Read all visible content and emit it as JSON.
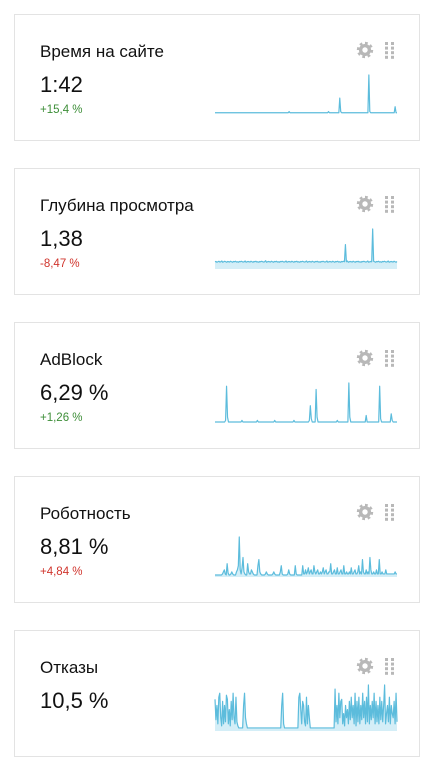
{
  "theme": {
    "spark_color": "#5cbcdc",
    "spark_fill": "#d4eef7",
    "icon_color": "#b8b8b8",
    "delta_up_color": "#3d8e38",
    "delta_down_color": "#d0342c"
  },
  "widgets": [
    {
      "title": "Время на сайте",
      "value": "1:42",
      "delta": "+15,4 %",
      "delta_direction": "up",
      "icons": [
        "gear-icon",
        "drag-handle-icon"
      ],
      "sparkline": {
        "fill": false,
        "values": [
          1,
          1,
          1,
          1,
          1,
          1,
          1,
          1,
          1,
          1,
          1,
          1,
          1,
          1,
          1,
          1,
          1,
          1,
          1,
          1,
          1,
          1,
          1,
          1,
          1,
          1,
          1,
          1,
          1,
          1,
          1,
          1,
          1,
          1,
          1,
          1,
          1,
          1,
          1,
          1,
          1,
          1,
          1,
          1,
          1,
          1,
          1,
          1,
          1,
          1,
          1,
          1,
          1,
          1,
          1,
          1,
          1,
          1,
          1,
          1,
          1,
          1,
          1,
          1,
          1,
          1,
          1,
          1,
          1,
          1,
          1,
          1,
          1,
          1,
          1,
          1,
          1,
          1,
          1,
          2,
          1,
          1,
          1,
          1,
          1,
          1,
          1,
          1,
          1,
          1,
          1,
          1,
          1,
          1,
          1,
          1,
          1,
          1,
          1,
          1,
          1,
          1,
          1,
          1,
          1,
          1,
          1,
          1,
          1,
          1,
          1,
          1,
          1,
          1,
          1,
          1,
          1,
          1,
          1,
          1,
          1,
          2,
          1,
          1,
          1,
          1,
          1,
          1,
          1,
          1,
          1,
          1,
          1,
          13,
          2,
          1,
          1,
          1,
          1,
          1,
          1,
          1,
          1,
          1,
          1,
          1,
          1,
          1,
          1,
          1,
          1,
          1,
          1,
          1,
          1,
          1,
          1,
          1,
          1,
          1,
          1,
          1,
          1,
          1,
          32,
          2,
          1,
          1,
          1,
          1,
          1,
          1,
          1,
          1,
          1,
          1,
          1,
          1,
          1,
          1,
          1,
          1,
          1,
          1,
          1,
          1,
          1,
          1,
          1,
          1,
          1,
          1,
          6,
          1,
          1
        ]
      }
    },
    {
      "title": "Глубина просмотра",
      "value": "1,38",
      "delta": "-8,47 %",
      "delta_direction": "down",
      "icons": [
        "gear-icon",
        "drag-handle-icon"
      ],
      "sparkline": {
        "fill": true,
        "values": [
          1.2,
          1.25,
          1.1,
          1.2,
          1.3,
          1.15,
          1.2,
          1.35,
          1.1,
          1.2,
          1.3,
          1.2,
          1.1,
          1.25,
          1.2,
          1.15,
          1.3,
          1.2,
          1.1,
          1.25,
          1.2,
          1.3,
          1.15,
          1.2,
          1.1,
          1.25,
          1.2,
          1.3,
          1.2,
          1.15,
          1.2,
          1.35,
          1.1,
          1.2,
          1.25,
          1.2,
          1.15,
          1.3,
          1.2,
          1.1,
          1.25,
          1.2,
          1.3,
          1.15,
          1.2,
          1.1,
          1.25,
          1.2,
          1.3,
          1.2,
          1.15,
          1.2,
          1.4,
          1.1,
          1.2,
          1.25,
          1.2,
          1.15,
          1.3,
          1.2,
          1.1,
          1.25,
          1.2,
          1.3,
          1.15,
          1.2,
          1.1,
          1.25,
          1.2,
          1.3,
          1.2,
          1.15,
          1.2,
          1.35,
          1.1,
          1.2,
          1.25,
          1.2,
          1.15,
          1.3,
          1.2,
          1.1,
          1.25,
          1.2,
          1.3,
          1.15,
          1.2,
          1.1,
          1.25,
          1.2,
          1.3,
          1.2,
          1.15,
          1.2,
          1.35,
          1.1,
          1.2,
          1.25,
          1.2,
          1.15,
          1.3,
          1.2,
          1.1,
          1.25,
          1.2,
          1.3,
          1.15,
          1.2,
          1.1,
          1.25,
          1.2,
          1.3,
          1.2,
          1.15,
          1.2,
          1.35,
          1.1,
          1.2,
          1.25,
          1.2,
          1.15,
          1.3,
          1.2,
          1.1,
          1.25,
          1.2,
          1.3,
          1.15,
          1.2,
          1.1,
          1.25,
          1.2,
          1.3,
          1.2,
          4.5,
          1.2,
          1.35,
          1.1,
          1.2,
          1.25,
          1.2,
          1.15,
          1.3,
          1.2,
          1.1,
          1.25,
          1.2,
          1.3,
          1.15,
          1.2,
          1.1,
          1.25,
          1.2,
          1.3,
          1.2,
          1.15,
          1.2,
          1.35,
          1.1,
          1.2,
          1.25,
          1.2,
          7.5,
          1.3,
          1.2,
          1.1,
          1.25,
          1.2,
          1.3,
          1.15,
          1.2,
          1.1,
          1.25,
          1.2,
          1.3,
          1.2,
          1.15,
          1.2,
          1.35,
          1.1,
          1.2,
          1.25,
          1.2,
          1.15,
          1.3,
          1.2,
          1.1,
          1.25
        ]
      }
    },
    {
      "title": "AdBlock",
      "value": "6,29 %",
      "delta": "+1,26 %",
      "delta_direction": "up",
      "icons": [
        "gear-icon",
        "drag-handle-icon"
      ],
      "sparkline": {
        "fill": false,
        "values": [
          0,
          0,
          0,
          0,
          0,
          0,
          0,
          0,
          0,
          0,
          0,
          1,
          22,
          3,
          0,
          0,
          0,
          0,
          0,
          0,
          0,
          0,
          0,
          0,
          0,
          0,
          0,
          0,
          1,
          0,
          0,
          0,
          0,
          0,
          0,
          0,
          0,
          0,
          0,
          0,
          0,
          0,
          0,
          0,
          1,
          0,
          0,
          0,
          0,
          0,
          0,
          0,
          0,
          0,
          0,
          0,
          0,
          0,
          0,
          0,
          0,
          0,
          1,
          0,
          0,
          0,
          0,
          0,
          0,
          0,
          0,
          0,
          0,
          0,
          0,
          0,
          0,
          0,
          0,
          0,
          0,
          0,
          1,
          0,
          0,
          0,
          0,
          0,
          0,
          0,
          0,
          0,
          0,
          0,
          0,
          0,
          0,
          0,
          1,
          10,
          2,
          0,
          0,
          0,
          0,
          20,
          3,
          0,
          0,
          0,
          0,
          0,
          0,
          0,
          0,
          0,
          0,
          0,
          0,
          0,
          0,
          0,
          0,
          0,
          0,
          0,
          0,
          1,
          0,
          0,
          0,
          0,
          0,
          0,
          0,
          0,
          0,
          0,
          0,
          24,
          3,
          0,
          0,
          0,
          0,
          0,
          0,
          0,
          0,
          0,
          0,
          0,
          0,
          0,
          0,
          0,
          0,
          4,
          0,
          0,
          0,
          0,
          0,
          0,
          0,
          0,
          0,
          0,
          0,
          0,
          0,
          22,
          2,
          0,
          0,
          0,
          0,
          0,
          0,
          0,
          0,
          0,
          0,
          5,
          1,
          0,
          0,
          0,
          0,
          0
        ]
      }
    },
    {
      "title": "Роботность",
      "value": "8,81 %",
      "delta": "+4,84 %",
      "delta_direction": "down",
      "icons": [
        "gear-icon",
        "drag-handle-icon"
      ],
      "sparkline": {
        "fill": true,
        "values": [
          0.5,
          0.5,
          0.5,
          0.5,
          0.5,
          0.5,
          0.5,
          0.5,
          1,
          2,
          3,
          1,
          0.5,
          6,
          1.5,
          0.5,
          0.5,
          1,
          2,
          1,
          0.5,
          0.5,
          0.5,
          2,
          3,
          5,
          19,
          3,
          1,
          4,
          9,
          2,
          1,
          0.5,
          0.5,
          6,
          2,
          1,
          1,
          3,
          2,
          1,
          0.5,
          0.5,
          0.5,
          0.5,
          5,
          8,
          2,
          1,
          0.5,
          0.5,
          0.5,
          0.5,
          1,
          2,
          1,
          0.5,
          0.5,
          0.5,
          0.5,
          0.5,
          1,
          2,
          1,
          0.5,
          0.5,
          0.5,
          0.5,
          0.5,
          2,
          5,
          1,
          0.5,
          0.5,
          0.5,
          0.5,
          0.5,
          1,
          3,
          1,
          0.5,
          0.5,
          0.5,
          0.5,
          0.5,
          5,
          1,
          0.5,
          0.5,
          0.5,
          0.5,
          0.5,
          0.5,
          5,
          1,
          1,
          3,
          1,
          2,
          4,
          1,
          2,
          3,
          1,
          1,
          5,
          2,
          1,
          2,
          3,
          1,
          1,
          2,
          1,
          2,
          4,
          1,
          2,
          3,
          1,
          1,
          2,
          2,
          6,
          1,
          1,
          2,
          3,
          1,
          1,
          4,
          1,
          1,
          2,
          3,
          1,
          1,
          5,
          1,
          1,
          2,
          1,
          1,
          2,
          1,
          4,
          1,
          1,
          2,
          3,
          1,
          1,
          2,
          5,
          1,
          2,
          1,
          8,
          2,
          1,
          1,
          3,
          1,
          2,
          1,
          9,
          3,
          1,
          1,
          2,
          1,
          1,
          3,
          1,
          1,
          8,
          1,
          1,
          2,
          1,
          1,
          1,
          3,
          1,
          1,
          1,
          1,
          1,
          1,
          1,
          1,
          1,
          2,
          1,
          1
        ]
      }
    },
    {
      "title": "Отказы",
      "value": "10,5 %",
      "delta": "",
      "delta_direction": "none",
      "icons": [
        "gear-icon",
        "drag-handle-icon"
      ],
      "sparkline": {
        "fill": true,
        "values": [
          15,
          5,
          12,
          3,
          16,
          18,
          6,
          2,
          14,
          3,
          12,
          4,
          17,
          15,
          3,
          10,
          2,
          14,
          5,
          18,
          6,
          3,
          16,
          4,
          2,
          1,
          1,
          1,
          1,
          1,
          12,
          18,
          6,
          3,
          1,
          1,
          1,
          1,
          1,
          1,
          1,
          1,
          1,
          1,
          1,
          1,
          1,
          1,
          1,
          1,
          1,
          1,
          1,
          1,
          1,
          1,
          1,
          1,
          1,
          1,
          1,
          1,
          1,
          1,
          1,
          1,
          1,
          1,
          1,
          1,
          12,
          18,
          3,
          1,
          1,
          1,
          1,
          1,
          1,
          1,
          1,
          1,
          1,
          1,
          1,
          1,
          1,
          1,
          16,
          18,
          10,
          3,
          14,
          12,
          4,
          2,
          16,
          3,
          12,
          6,
          1,
          1,
          1,
          1,
          1,
          1,
          1,
          1,
          1,
          1,
          1,
          1,
          1,
          1,
          1,
          1,
          1,
          1,
          1,
          1,
          1,
          1,
          1,
          1,
          1,
          1,
          20,
          4,
          12,
          3,
          18,
          6,
          14,
          15,
          3,
          8,
          2,
          12,
          6,
          10,
          3,
          14,
          5,
          16,
          6,
          12,
          3,
          18,
          2,
          14,
          4,
          16,
          3,
          12,
          5,
          18,
          6,
          14,
          3,
          16,
          4,
          22,
          3,
          12,
          5,
          14,
          6,
          18,
          3,
          14,
          4,
          12,
          3,
          16,
          5,
          14,
          4,
          12,
          22,
          3,
          8,
          12,
          4,
          16,
          3,
          12,
          8,
          6,
          14,
          3,
          18,
          4
        ]
      }
    }
  ]
}
